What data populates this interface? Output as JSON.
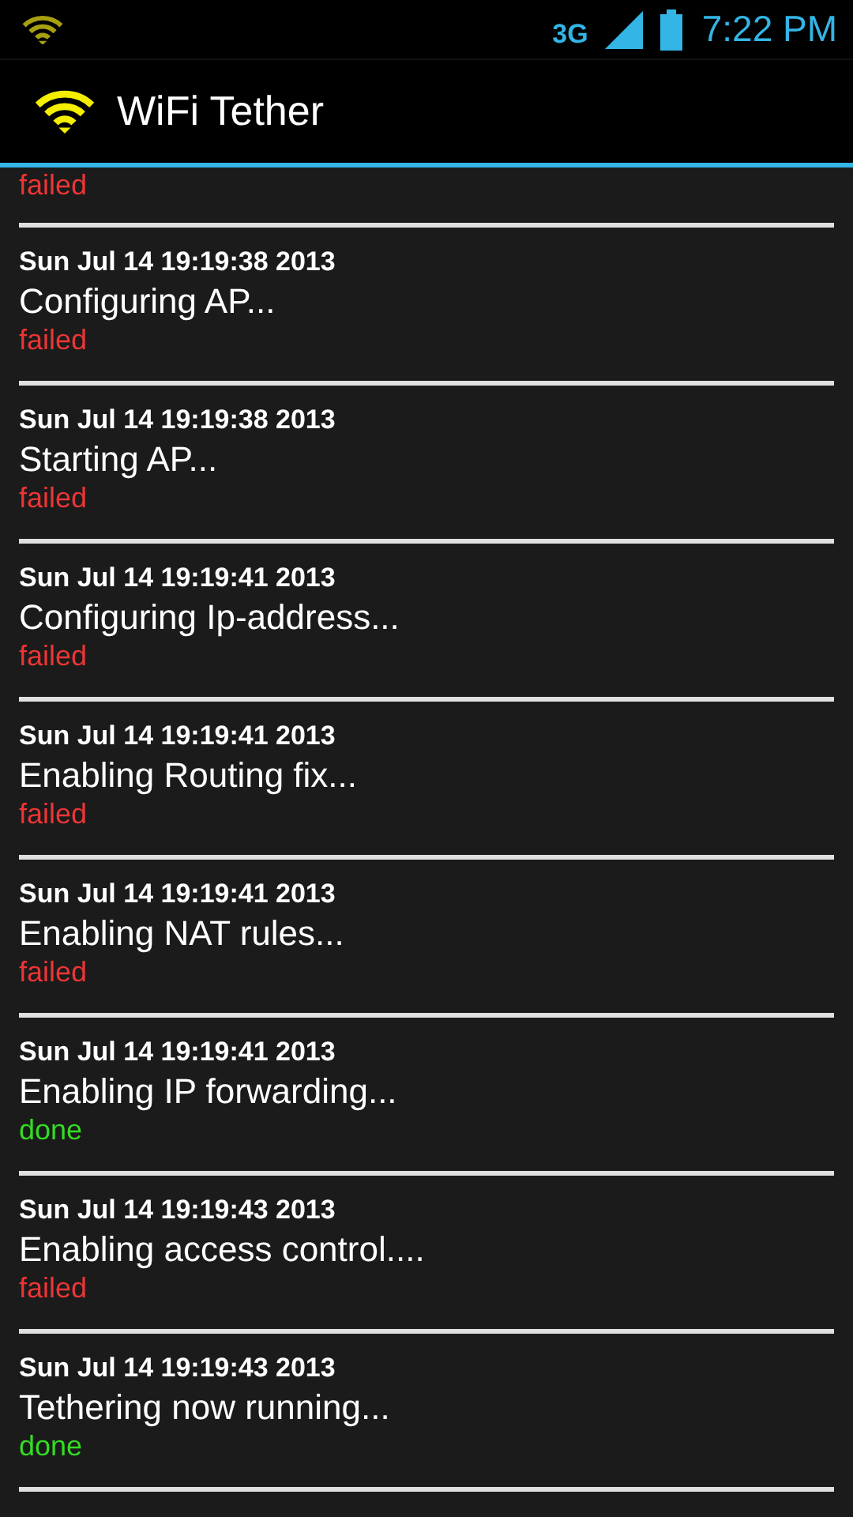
{
  "status_bar": {
    "network": "3G",
    "time": "7:22 PM"
  },
  "app_bar": {
    "title": "WiFi Tether"
  },
  "log": [
    {
      "status": {
        "text": "failed",
        "kind": "failed"
      }
    },
    {
      "time": "Sun Jul 14 19:19:38 2013",
      "message": "Configuring AP...",
      "status": {
        "text": "failed",
        "kind": "failed"
      }
    },
    {
      "time": "Sun Jul 14 19:19:38 2013",
      "message": "Starting AP...",
      "status": {
        "text": "failed",
        "kind": "failed"
      }
    },
    {
      "time": "Sun Jul 14 19:19:41 2013",
      "message": "Configuring Ip-address...",
      "status": {
        "text": "failed",
        "kind": "failed"
      }
    },
    {
      "time": "Sun Jul 14 19:19:41 2013",
      "message": "Enabling Routing fix...",
      "status": {
        "text": "failed",
        "kind": "failed"
      }
    },
    {
      "time": "Sun Jul 14 19:19:41 2013",
      "message": "Enabling NAT rules...",
      "status": {
        "text": "failed",
        "kind": "failed"
      }
    },
    {
      "time": "Sun Jul 14 19:19:41 2013",
      "message": "Enabling IP forwarding...",
      "status": {
        "text": "done",
        "kind": "done"
      }
    },
    {
      "time": "Sun Jul 14 19:19:43 2013",
      "message": "Enabling access control....",
      "status": {
        "text": "failed",
        "kind": "failed"
      }
    },
    {
      "time": "Sun Jul 14 19:19:43 2013",
      "message": "Tethering now running...",
      "status": {
        "text": "done",
        "kind": "done"
      }
    }
  ]
}
